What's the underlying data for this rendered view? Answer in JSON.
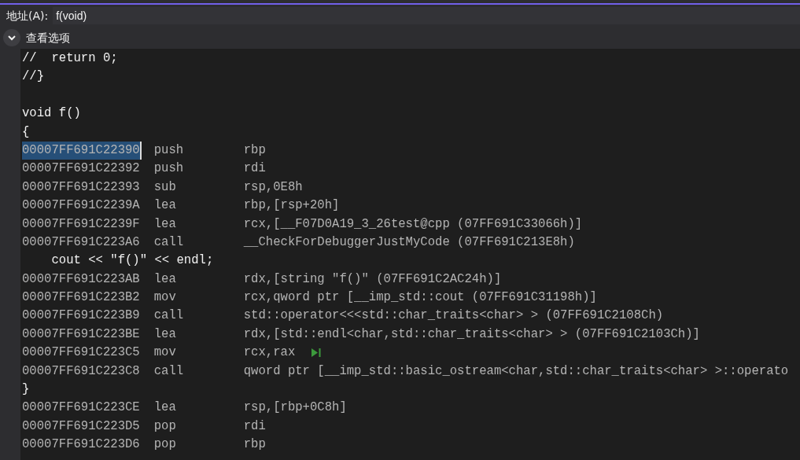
{
  "address_bar": {
    "label": "地址(A):",
    "value": "f(void)"
  },
  "view_options": {
    "label": "查看选项",
    "expanded": true
  },
  "lines": [
    {
      "kind": "source",
      "text": "//  return 0;"
    },
    {
      "kind": "source",
      "text": "//}"
    },
    {
      "kind": "blank"
    },
    {
      "kind": "source",
      "text": "void f()"
    },
    {
      "kind": "source",
      "text": "{"
    },
    {
      "kind": "asm",
      "address": "00007FF691C22390",
      "mnemonic": "push",
      "operands": "rbp",
      "selected": true,
      "next_statement": false
    },
    {
      "kind": "asm",
      "address": "00007FF691C22392",
      "mnemonic": "push",
      "operands": "rdi",
      "selected": false,
      "next_statement": false
    },
    {
      "kind": "asm",
      "address": "00007FF691C22393",
      "mnemonic": "sub",
      "operands": "rsp,0E8h",
      "selected": false,
      "next_statement": false
    },
    {
      "kind": "asm",
      "address": "00007FF691C2239A",
      "mnemonic": "lea",
      "operands": "rbp,[rsp+20h]",
      "selected": false,
      "next_statement": false
    },
    {
      "kind": "asm",
      "address": "00007FF691C2239F",
      "mnemonic": "lea",
      "operands": "rcx,[__F07D0A19_3_26test@cpp (07FF691C33066h)]",
      "selected": false,
      "next_statement": false
    },
    {
      "kind": "asm",
      "address": "00007FF691C223A6",
      "mnemonic": "call",
      "operands": "__CheckForDebuggerJustMyCode (07FF691C213E8h)",
      "selected": false,
      "next_statement": false
    },
    {
      "kind": "source",
      "text": "    cout << \"f()\" << endl;"
    },
    {
      "kind": "asm",
      "address": "00007FF691C223AB",
      "mnemonic": "lea",
      "operands": "rdx,[string \"f()\" (07FF691C2AC24h)]",
      "selected": false,
      "next_statement": false
    },
    {
      "kind": "asm",
      "address": "00007FF691C223B2",
      "mnemonic": "mov",
      "operands": "rcx,qword ptr [__imp_std::cout (07FF691C31198h)]",
      "selected": false,
      "next_statement": false
    },
    {
      "kind": "asm",
      "address": "00007FF691C223B9",
      "mnemonic": "call",
      "operands": "std::operator<<<std::char_traits<char> > (07FF691C2108Ch)",
      "selected": false,
      "next_statement": false
    },
    {
      "kind": "asm",
      "address": "00007FF691C223BE",
      "mnemonic": "lea",
      "operands": "rdx,[std::endl<char,std::char_traits<char> > (07FF691C2103Ch)]",
      "selected": false,
      "next_statement": false
    },
    {
      "kind": "asm",
      "address": "00007FF691C223C5",
      "mnemonic": "mov",
      "operands": "rcx,rax",
      "selected": false,
      "next_statement": true
    },
    {
      "kind": "asm",
      "address": "00007FF691C223C8",
      "mnemonic": "call",
      "operands": "qword ptr [__imp_std::basic_ostream<char,std::char_traits<char> >::operato",
      "selected": false,
      "next_statement": false
    },
    {
      "kind": "source",
      "text": "}"
    },
    {
      "kind": "asm",
      "address": "00007FF691C223CE",
      "mnemonic": "lea",
      "operands": "rsp,[rbp+0C8h]",
      "selected": false,
      "next_statement": false
    },
    {
      "kind": "asm",
      "address": "00007FF691C223D5",
      "mnemonic": "pop",
      "operands": "rdi",
      "selected": false,
      "next_statement": false
    },
    {
      "kind": "asm",
      "address": "00007FF691C223D6",
      "mnemonic": "pop",
      "operands": "rbp",
      "selected": false,
      "next_statement": false
    }
  ]
}
